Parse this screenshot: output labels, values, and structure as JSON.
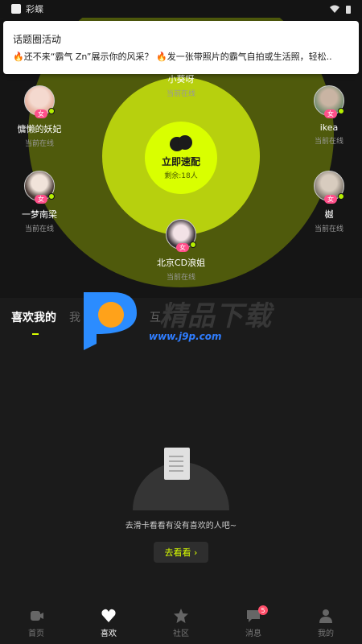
{
  "status_bar": {
    "app_name": "彩蝶"
  },
  "notification": {
    "title": "话题圈活动",
    "body": "🔥还不来“霸气 Zn”展示你的风采？ 🔥发一张带照片的霸气自拍或生活照，轻松.."
  },
  "radar": {
    "center": {
      "title": "立即速配",
      "subtitle": "剩余:18人"
    },
    "users": [
      {
        "name": "小葵呀",
        "status": "当前在线"
      },
      {
        "name": "慵懒的妖妃",
        "status": "当前在线",
        "gender": "女"
      },
      {
        "name": "ikea",
        "status": "当前在线",
        "gender": "女"
      },
      {
        "name": "一梦南梁",
        "status": "当前在线",
        "gender": "女"
      },
      {
        "name": "樾",
        "status": "当前在线",
        "gender": "女"
      },
      {
        "name": "北京CD浪姐",
        "status": "当前在线",
        "gender": "女"
      }
    ]
  },
  "tabs": [
    "喜欢我的",
    "我",
    "互"
  ],
  "watermark": {
    "text": "精品下载",
    "url": "www.j9p.com"
  },
  "empty_state": {
    "message": "去滑卡看看有没有喜欢的人吧~",
    "button": "去看看 ›"
  },
  "bottom_nav": [
    {
      "label": "首页",
      "icon": "video-icon"
    },
    {
      "label": "喜欢",
      "icon": "heart-icon"
    },
    {
      "label": "社区",
      "icon": "star-icon"
    },
    {
      "label": "消息",
      "icon": "chat-icon",
      "badge": "5"
    },
    {
      "label": "我的",
      "icon": "profile-icon"
    }
  ],
  "colors": {
    "accent": "#d9ff00",
    "ring_inner": "#b7d00e",
    "ring_outer": "#4f5a0c",
    "badge": "#ff4f8a"
  }
}
